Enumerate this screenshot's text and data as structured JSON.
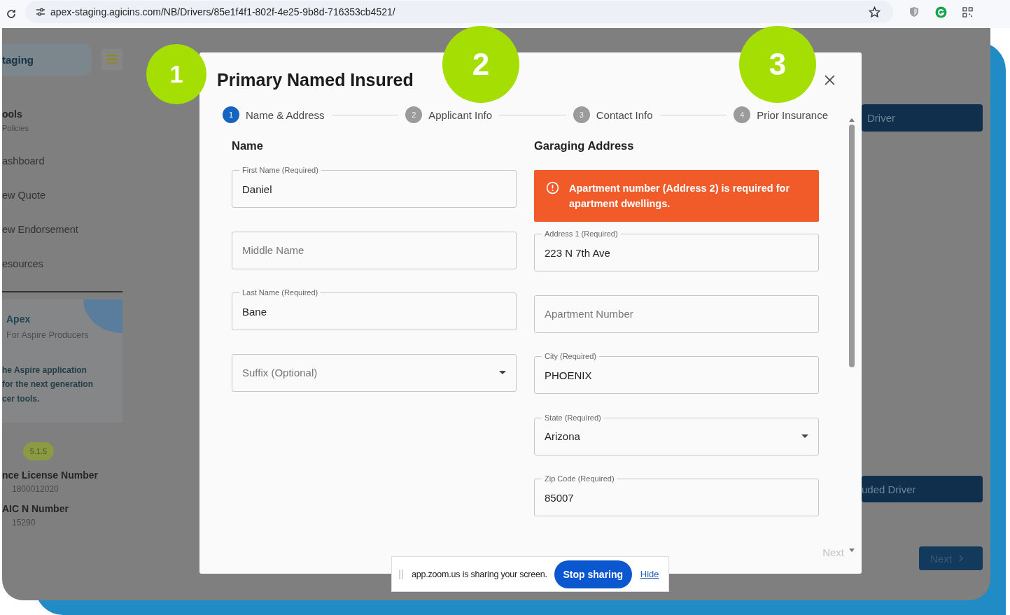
{
  "browser": {
    "url": "apex-staging.agicins.com/NB/Drivers/85e1f4f1-802f-4e25-9b8d-716353cb4521/"
  },
  "sidebar": {
    "brand": "taging",
    "section_title": "ools",
    "section_subtitle": "Policies",
    "nav": [
      {
        "label": "ashboard"
      },
      {
        "label": "ew Quote"
      },
      {
        "label": "ew Endorsement"
      },
      {
        "label": "esources"
      }
    ],
    "promo": {
      "title": "Apex",
      "subtitle": "For Aspire Producers",
      "lines": [
        "he Aspire application",
        "for the next generation",
        "cer tools."
      ]
    },
    "version": "5.1.5",
    "info": [
      {
        "label": "nce License Number",
        "value": "1800012020"
      },
      {
        "label": "AIC N Number",
        "value": "15290"
      }
    ]
  },
  "background_buttons": [
    {
      "label": "Driver"
    },
    {
      "label": "uded Driver"
    },
    {
      "label": "Next"
    }
  ],
  "dialog": {
    "title": "Primary Named Insured",
    "steps": [
      {
        "number": "1",
        "label": "Name & Address",
        "selected": true
      },
      {
        "number": "2",
        "label": "Applicant Info",
        "selected": false
      },
      {
        "number": "3",
        "label": "Contact Info",
        "selected": false
      },
      {
        "number": "4",
        "label": "Prior Insurance",
        "selected": false
      }
    ],
    "sections": [
      {
        "title": "Name",
        "fields": [
          {
            "kind": "text",
            "label": "First Name (Required)",
            "value": "Daniel"
          },
          {
            "kind": "text",
            "placeholder": "Middle Name"
          },
          {
            "kind": "text",
            "label": "Last Name (Required)",
            "value": "Bane"
          },
          {
            "kind": "select",
            "placeholder": "Suffix (Optional)"
          }
        ]
      },
      {
        "title": "Garaging Address",
        "alert": "Apartment number (Address 2) is required for apartment dwellings.",
        "fields": [
          {
            "kind": "text",
            "label": "Address 1 (Required)",
            "value": "223 N 7th Ave"
          },
          {
            "kind": "text",
            "placeholder": "Apartment Number"
          },
          {
            "kind": "text",
            "label": "City (Required)",
            "value": "PHOENIX"
          },
          {
            "kind": "select",
            "label": "State (Required)",
            "value": "Arizona"
          },
          {
            "kind": "text",
            "label": "Zip Code (Required)",
            "value": "85007"
          }
        ]
      }
    ],
    "next_button": {
      "label": "Next",
      "disabled": true
    }
  },
  "callouts": [
    "1",
    "2",
    "3"
  ],
  "share_bar": {
    "message": "app.zoom.us is sharing your screen.",
    "stop_button": "Stop sharing",
    "hide_link": "Hide"
  }
}
